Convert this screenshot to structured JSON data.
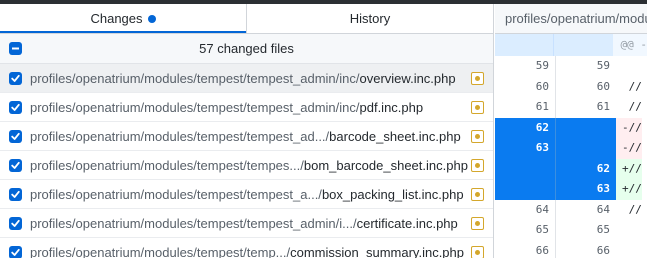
{
  "tabs": {
    "changes_label": "Changes",
    "history_label": "History"
  },
  "summary": {
    "count_text": "57 changed files"
  },
  "files": [
    {
      "dir": "profiles/openatrium/modules/tempest/tempest_admin/inc/",
      "name": "overview.inc.php",
      "checked": true,
      "selected": true
    },
    {
      "dir": "profiles/openatrium/modules/tempest/tempest_admin/inc/",
      "name": "pdf.inc.php",
      "checked": true,
      "selected": false
    },
    {
      "dir": "profiles/openatrium/modules/tempest/tempest_ad.../",
      "name": "barcode_sheet.inc.php",
      "checked": true,
      "selected": false
    },
    {
      "dir": "profiles/openatrium/modules/tempest/tempes.../",
      "name": "bom_barcode_sheet.inc.php",
      "checked": true,
      "selected": false
    },
    {
      "dir": "profiles/openatrium/modules/tempest/tempest_a.../",
      "name": "box_packing_list.inc.php",
      "checked": true,
      "selected": false
    },
    {
      "dir": "profiles/openatrium/modules/tempest/tempest_admin/i.../",
      "name": "certificate.inc.php",
      "checked": true,
      "selected": false
    },
    {
      "dir": "profiles/openatrium/modules/tempest/temp.../",
      "name": "commission_summary.inc.php",
      "checked": true,
      "selected": false
    }
  ],
  "diff": {
    "header_path": "profiles/openatrium/modu",
    "hunk_text": "@@ -",
    "lines": [
      {
        "type": "context",
        "old": "59",
        "new": "59",
        "code": ""
      },
      {
        "type": "context",
        "old": "60",
        "new": "60",
        "code": " //"
      },
      {
        "type": "context",
        "old": "61",
        "new": "61",
        "code": " //"
      },
      {
        "type": "del",
        "old": "62",
        "new": "",
        "code": "-//"
      },
      {
        "type": "del",
        "old": "63",
        "new": "",
        "code": "-//"
      },
      {
        "type": "add",
        "old": "",
        "new": "62",
        "code": "+//"
      },
      {
        "type": "add",
        "old": "",
        "new": "63",
        "code": "+//"
      },
      {
        "type": "context",
        "old": "64",
        "new": "64",
        "code": " //"
      },
      {
        "type": "context",
        "old": "65",
        "new": "65",
        "code": ""
      },
      {
        "type": "context",
        "old": "66",
        "new": "66",
        "code": ""
      }
    ]
  },
  "colors": {
    "accent": "#0366d6",
    "modified": "#d4a72c",
    "selected_gutter": "#0a7bf0"
  }
}
